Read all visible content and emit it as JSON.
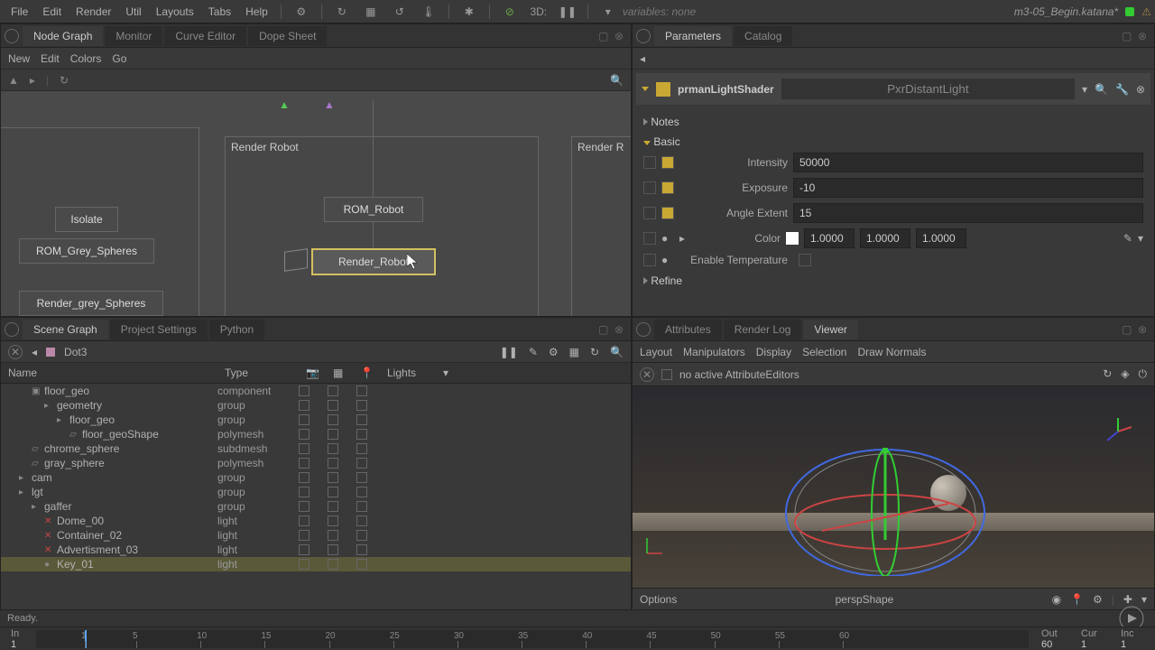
{
  "menubar": {
    "items": [
      "File",
      "Edit",
      "Render",
      "Util",
      "Layouts",
      "Tabs",
      "Help"
    ],
    "threed": "3D:",
    "variables": "variables: none",
    "filename": "m3-05_Begin.katana*"
  },
  "nodegraph": {
    "tabs": [
      "Node Graph",
      "Monitor",
      "Curve Editor",
      "Dope Sheet"
    ],
    "submenu": [
      "New",
      "Edit",
      "Colors",
      "Go"
    ],
    "group1_label": "Render Robot",
    "group2_label": "Render R",
    "nodes": {
      "isolate": "Isolate",
      "rom_grey": "ROM_Grey_Spheres",
      "render_grey": "Render_grey_Spheres",
      "rom_robot": "ROM_Robot",
      "render_robot": "Render_Robot"
    }
  },
  "parameters": {
    "tabs": [
      "Parameters",
      "Catalog"
    ],
    "shader_label": "prmanLightShader",
    "shader_type": "PxrDistantLight",
    "sections": {
      "notes": "Notes",
      "basic": "Basic",
      "refine": "Refine"
    },
    "params": {
      "intensity": {
        "label": "Intensity",
        "value": "50000"
      },
      "exposure": {
        "label": "Exposure",
        "value": "-10"
      },
      "angle": {
        "label": "Angle Extent",
        "value": "15"
      },
      "color": {
        "label": "Color",
        "r": "1.0000",
        "g": "1.0000",
        "b": "1.0000"
      },
      "enable_temp": {
        "label": "Enable Temperature"
      }
    }
  },
  "scenegraph": {
    "tabs": [
      "Scene Graph",
      "Project Settings",
      "Python"
    ],
    "current_node": "Dot3",
    "headers": {
      "name": "Name",
      "type": "Type",
      "lights": "Lights"
    },
    "rows": [
      {
        "indent": 2,
        "icon": "box",
        "name": "floor_geo",
        "type": "component"
      },
      {
        "indent": 3,
        "icon": "grp",
        "name": "geometry",
        "type": "group"
      },
      {
        "indent": 4,
        "icon": "grp",
        "name": "floor_geo",
        "type": "group"
      },
      {
        "indent": 5,
        "icon": "mesh",
        "name": "floor_geoShape",
        "type": "polymesh"
      },
      {
        "indent": 2,
        "icon": "mesh",
        "name": "chrome_sphere",
        "type": "subdmesh"
      },
      {
        "indent": 2,
        "icon": "mesh",
        "name": "gray_sphere",
        "type": "polymesh"
      },
      {
        "indent": 1,
        "icon": "grp",
        "name": "cam",
        "type": "group"
      },
      {
        "indent": 1,
        "icon": "grp",
        "name": "lgt",
        "type": "group"
      },
      {
        "indent": 2,
        "icon": "grp",
        "name": "gaffer",
        "type": "group"
      },
      {
        "indent": 3,
        "icon": "x",
        "name": "Dome_00",
        "type": "light"
      },
      {
        "indent": 3,
        "icon": "x",
        "name": "Container_02",
        "type": "light"
      },
      {
        "indent": 3,
        "icon": "x",
        "name": "Advertisment_03",
        "type": "light"
      },
      {
        "indent": 3,
        "icon": "dot",
        "name": "Key_01",
        "type": "light",
        "selected": true
      }
    ]
  },
  "viewer": {
    "tabs": [
      "Attributes",
      "Render Log",
      "Viewer"
    ],
    "menu": [
      "Layout",
      "Manipulators",
      "Display",
      "Selection",
      "Draw Normals"
    ],
    "status": "no active AttributeEditors",
    "bottom": {
      "options": "Options",
      "camera": "perspShape"
    }
  },
  "status": "Ready.",
  "timeline": {
    "in": "In",
    "out": "Out",
    "cur": "Cur",
    "inc": "Inc",
    "start": "1",
    "end": "60",
    "cur_val": "1",
    "inc_val": "1",
    "ticks": [
      "1",
      "5",
      "10",
      "15",
      "20",
      "25",
      "30",
      "35",
      "40",
      "45",
      "50",
      "55",
      "60"
    ]
  }
}
